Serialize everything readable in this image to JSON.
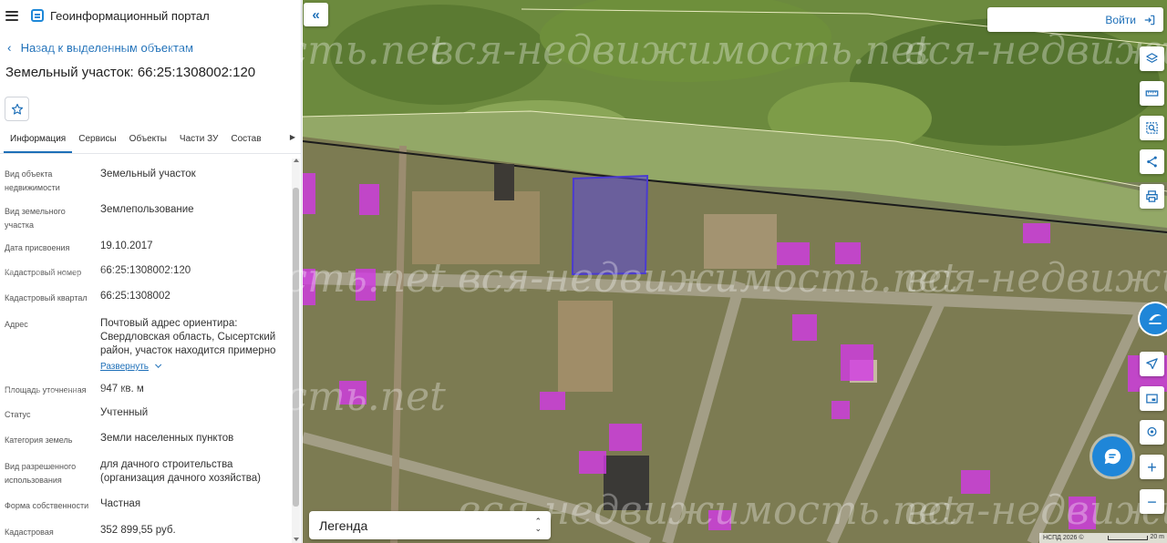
{
  "header": {
    "title": "Геоинформационный портал"
  },
  "panel": {
    "back_link": "Назад к выделенным объектам",
    "title": "Земельный участок: 66:25:1308002:120",
    "tabs": [
      "Информация",
      "Сервисы",
      "Объекты",
      "Части ЗУ",
      "Состав"
    ],
    "attributes": [
      {
        "label": "Вид объекта недвижимости",
        "value": "Земельный участок"
      },
      {
        "label": "Вид земельного участка",
        "value": "Землепользование"
      },
      {
        "label": "Дата присвоения",
        "value": "19.10.2017"
      },
      {
        "label": "Кадастровый номер",
        "value": "66:25:1308002:120"
      },
      {
        "label": "Кадастровый квартал",
        "value": "66:25:1308002"
      },
      {
        "label": "Адрес",
        "value": "Почтовый адрес ориентира: Свердловская область, Сысертский район, участок находится примерно"
      },
      {
        "label": "Площадь уточненная",
        "value": "947 кв. м"
      },
      {
        "label": "Статус",
        "value": "Учтенный"
      },
      {
        "label": "Категория земель",
        "value": "Земли населенных пунктов"
      },
      {
        "label": "Вид разрешенного использования",
        "value": "для дачного строительства (организация дачного хозяйства)"
      },
      {
        "label": "Форма собственности",
        "value": "Частная"
      },
      {
        "label": "Кадастровая",
        "value": "352 899,55 руб."
      }
    ],
    "expand_label": "Развернуть"
  },
  "map": {
    "login_label": "Войти",
    "legend_label": "Легенда",
    "attribution": "НСПД 2026 ©",
    "scale": "20 m",
    "watermark": "вся-недвижимость.net",
    "colors": {
      "selected_parcel": "#5b49d8",
      "other_parcels": "#d23ae6",
      "accent": "#1d6fb8",
      "floating_button": "#1f86d8"
    }
  }
}
